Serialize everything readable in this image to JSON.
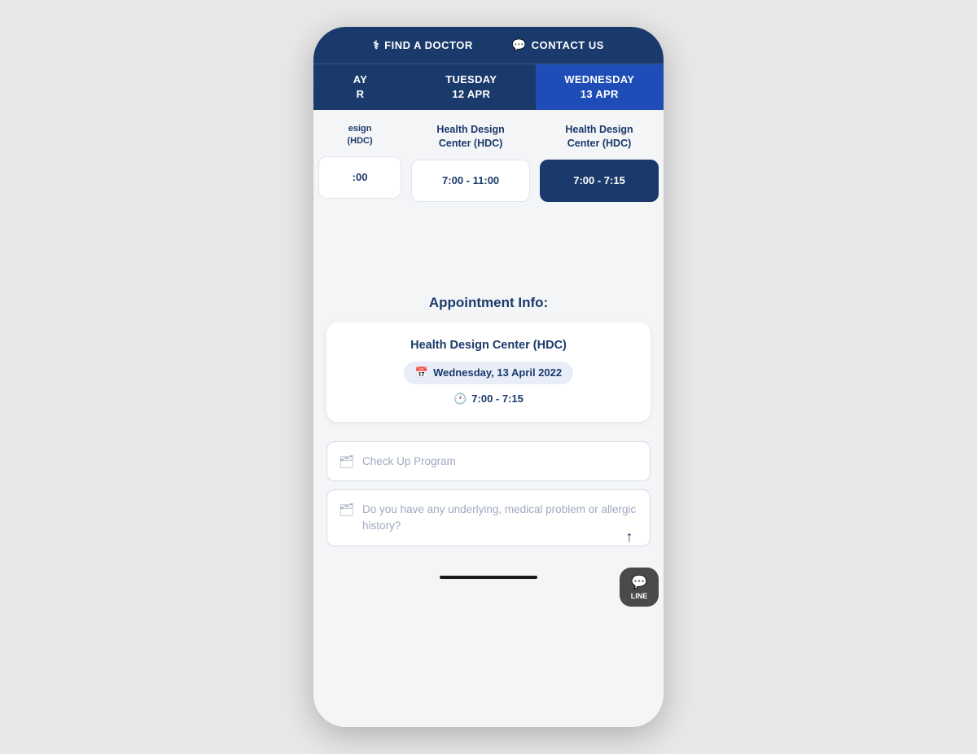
{
  "nav": {
    "find_doctor": "FIND A DOCTOR",
    "contact_us": "CONTACT US"
  },
  "calendar": {
    "columns": [
      {
        "id": "partial",
        "day": "AY",
        "date": "R",
        "partial": true
      },
      {
        "id": "tuesday",
        "day": "TUESDAY",
        "date": "12 APR",
        "partial": false
      },
      {
        "id": "wednesday",
        "day": "WEDNESDAY",
        "date": "13 APR",
        "partial": false,
        "active": true
      }
    ],
    "rows": [
      {
        "locations": [
          {
            "text": "esign\nHDC)",
            "partial": true
          },
          {
            "text": "Health Design\nCenter (HDC)",
            "partial": false
          },
          {
            "text": "Health Design\nCenter (HDC)",
            "partial": false
          }
        ],
        "slots": [
          {
            "time": ":00",
            "partial": true
          },
          {
            "time": "7:00 - 11:00",
            "active": false
          },
          {
            "time": "7:00 - 7:15",
            "active": true
          }
        ]
      }
    ]
  },
  "appointment_info": {
    "title": "Appointment Info:",
    "facility": "Health Design Center (HDC)",
    "date_label": "Wednesday, 13 April 2022",
    "time_label": "7:00 - 7:15"
  },
  "form": {
    "checkup_placeholder": "Check Up Program",
    "medical_placeholder": "Do you have any underlying, medical problem or allergic history?"
  },
  "line_button": {
    "label": "LINE"
  },
  "home_indicator": true
}
